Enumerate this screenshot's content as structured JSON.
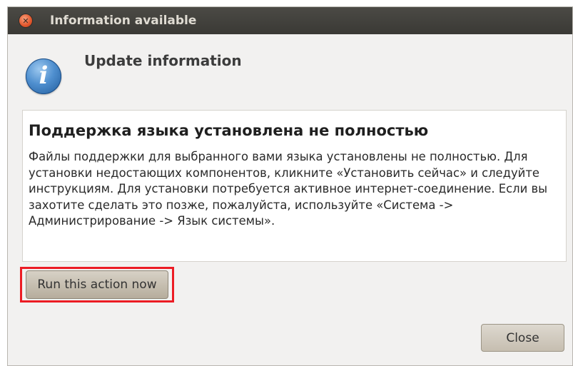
{
  "window": {
    "title": "Information available"
  },
  "header": {
    "icon": "info-icon",
    "icon_glyph": "i",
    "heading": "Update information"
  },
  "content": {
    "title": "Поддержка языка установлена не полностью",
    "body": "Файлы поддержки для выбранного вами языка установлены не полностью. Для установки недостающих компонентов, кликните «Установить сейчас» и следуйте инструкциям. Для установки потребуется активное интернет-соединение. Если вы захотите сделать это позже, пожалуйста, используйте «Система -> Администрирование -> Язык системы»."
  },
  "actions": {
    "run_label": "Run this action now",
    "close_label": "Close"
  },
  "colors": {
    "highlight": "#ec1c24",
    "titlebar": "#3c3b37",
    "close_button": "#e2562c",
    "info_icon": "#4f8fcf"
  }
}
